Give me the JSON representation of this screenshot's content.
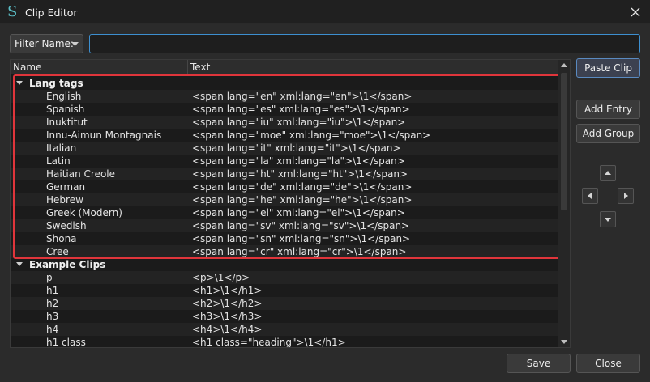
{
  "window": {
    "title": "Clip Editor"
  },
  "filter": {
    "label": "Filter Name:",
    "value": ""
  },
  "columns": {
    "name": "Name",
    "text": "Text"
  },
  "groups": [
    {
      "name": "Lang tags",
      "items": [
        {
          "name": "English",
          "text": "<span lang=\"en\" xml:lang=\"en\">\\1</span>"
        },
        {
          "name": "Spanish",
          "text": "<span lang=\"es\" xml:lang=\"es\">\\1</span>"
        },
        {
          "name": "Inuktitut",
          "text": "<span lang=\"iu\" xml:lang=\"iu\">\\1</span>"
        },
        {
          "name": "Innu-Aimun Montagnais",
          "text": "<span lang=\"moe\" xml:lang=\"moe\">\\1</span>"
        },
        {
          "name": "Italian",
          "text": "<span lang=\"it\" xml:lang=\"it\">\\1</span>"
        },
        {
          "name": "Latin",
          "text": "<span lang=\"la\" xml:lang=\"la\">\\1</span>"
        },
        {
          "name": "Haitian Creole",
          "text": "<span lang=\"ht\" xml:lang=\"ht\">\\1</span>"
        },
        {
          "name": "German",
          "text": "<span lang=\"de\" xml:lang=\"de\">\\1</span>"
        },
        {
          "name": "Hebrew",
          "text": "<span lang=\"he\" xml:lang=\"he\">\\1</span>"
        },
        {
          "name": "Greek (Modern)",
          "text": "<span lang=\"el\" xml:lang=\"el\">\\1</span>"
        },
        {
          "name": "Swedish",
          "text": "<span lang=\"sv\" xml:lang=\"sv\">\\1</span>"
        },
        {
          "name": "Shona",
          "text": "<span lang=\"sn\" xml:lang=\"sn\">\\1</span>"
        },
        {
          "name": "Cree",
          "text": "<span lang=\"cr\" xml:lang=\"cr\">\\1</span>"
        }
      ]
    },
    {
      "name": "Example Clips",
      "items": [
        {
          "name": "p",
          "text": "<p>\\1</p>"
        },
        {
          "name": "h1",
          "text": "<h1>\\1</h1>"
        },
        {
          "name": "h2",
          "text": "<h2>\\1</h2>"
        },
        {
          "name": "h3",
          "text": "<h3>\\1</h3>"
        },
        {
          "name": "h4",
          "text": "<h4>\\1</h4>"
        },
        {
          "name": "h1 class",
          "text": "<h1 class=\"heading\">\\1</h1>"
        }
      ]
    }
  ],
  "buttons": {
    "paste_clip": "Paste Clip",
    "add_entry": "Add Entry",
    "add_group": "Add Group",
    "save": "Save",
    "close": "Close"
  },
  "colors": {
    "accent": "#3d8fd0",
    "highlight": "#e0353b",
    "background": "#2b2b2b"
  }
}
